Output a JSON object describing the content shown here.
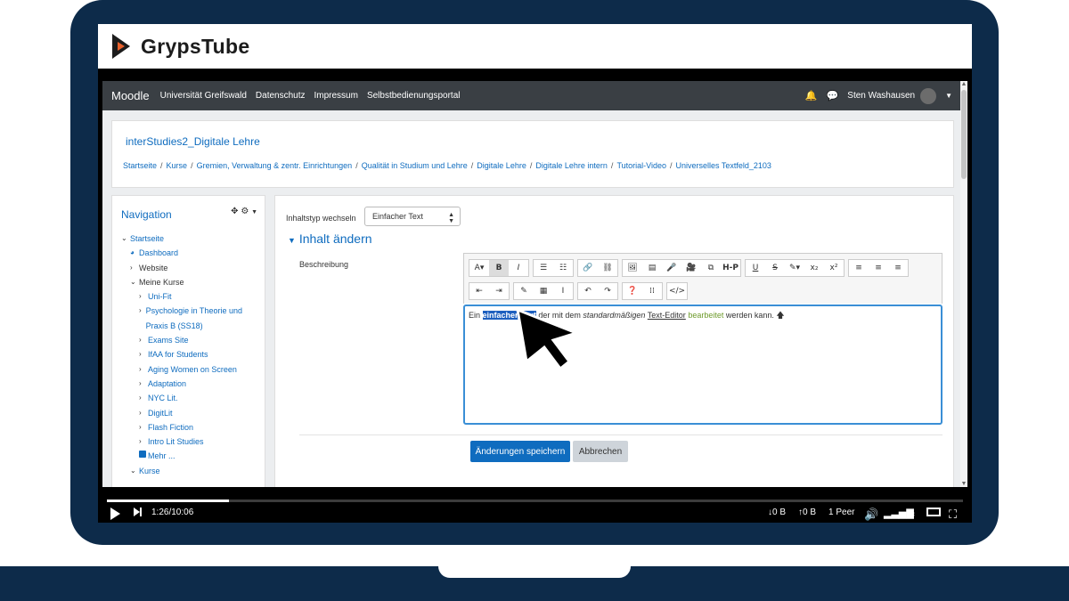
{
  "header": {
    "title": "GrypsTube",
    "logo_icon": "grypstube-logo-icon",
    "logo_colors": [
      "#1c1c1c",
      "#e8612c"
    ]
  },
  "navbar": {
    "brand": "Moodle",
    "links": [
      "Universität Greifswald",
      "Datenschutz",
      "Impressum",
      "Selbstbedienungsportal"
    ],
    "user_name": "Sten Washausen",
    "icons": [
      "bell-icon",
      "chat-icon",
      "avatar",
      "caret-down-icon"
    ]
  },
  "course": {
    "title": "interStudies2_Digitale Lehre",
    "breadcrumb": [
      "Startseite",
      "Kurse",
      "Gremien, Verwaltung & zentr. Einrichtungen",
      "Qualität in Studium und Lehre",
      "Digitale Lehre",
      "Digitale Lehre intern",
      "Tutorial-Video",
      "Universelles Textfeld_2103"
    ]
  },
  "navigation": {
    "heading": "Navigation",
    "items": [
      {
        "label": "Startseite",
        "chevron": "v",
        "indent": 0,
        "link": true
      },
      {
        "label": "Dashboard",
        "chevron": "",
        "indent": 1,
        "link": true,
        "icon": "dashboard-icon"
      },
      {
        "label": "Website",
        "chevron": ">",
        "indent": 1,
        "link": false
      },
      {
        "label": "Meine Kurse",
        "chevron": "v",
        "indent": 1,
        "link": false
      },
      {
        "label": "Uni-Fit",
        "chevron": ">",
        "indent": 2,
        "link": true
      },
      {
        "label": "Psychologie in Theorie und Praxis B (SS18)",
        "chevron": ">",
        "indent": 2,
        "link": true
      },
      {
        "label": "Exams Site",
        "chevron": ">",
        "indent": 2,
        "link": true
      },
      {
        "label": "IfAA for Students",
        "chevron": ">",
        "indent": 2,
        "link": true
      },
      {
        "label": "Aging Women on Screen",
        "chevron": ">",
        "indent": 2,
        "link": true
      },
      {
        "label": "Adaptation",
        "chevron": ">",
        "indent": 2,
        "link": true
      },
      {
        "label": "NYC Lit.",
        "chevron": ">",
        "indent": 2,
        "link": true
      },
      {
        "label": "DigitLit",
        "chevron": ">",
        "indent": 2,
        "link": true
      },
      {
        "label": "Flash Fiction",
        "chevron": ">",
        "indent": 2,
        "link": true
      },
      {
        "label": "Intro Lit Studies",
        "chevron": ">",
        "indent": 2,
        "link": true
      },
      {
        "label": "Mehr ...",
        "chevron": "",
        "indent": 2,
        "link": true,
        "icon": "folder-icon"
      },
      {
        "label": "Kurse",
        "chevron": "v",
        "indent": 1,
        "link": true
      }
    ]
  },
  "form": {
    "type_label": "Inhaltstyp wechseln",
    "type_value": "Einfacher Text",
    "section_title": "Inhalt ändern",
    "desc_label": "Beschreibung",
    "editor_text": {
      "t1": "Ein ",
      "t2": "einfacher Text",
      "t3": " der mit dem ",
      "t4": "standardmäßigen",
      "t5": " ",
      "t6": "Text-Editor",
      "t7": " ",
      "t8": "bearbeitet",
      "t9": " werden kann. ",
      "t10": "🡅"
    },
    "save_label": "Änderungen speichern",
    "cancel_label": "Abbrechen"
  },
  "toolbar": {
    "row1": [
      [
        "A▾",
        "B",
        "I"
      ],
      [
        "☰",
        "☷"
      ],
      [
        "🔗",
        "⛓"
      ],
      [
        "🖼",
        "▤",
        "🎤",
        "🎥",
        "⧉",
        "H-P"
      ],
      [
        "U",
        "S",
        "✎▾",
        "x₂",
        "x²"
      ],
      [
        "≡",
        "≡",
        "≡"
      ]
    ],
    "row2": [
      [
        "⇤",
        "⇥"
      ],
      [
        "✎",
        "▦",
        "I"
      ],
      [
        "↶",
        "↷"
      ],
      [
        "❓",
        "⁞⁞"
      ],
      [
        "</>"
      ]
    ]
  },
  "player": {
    "time": "1:26/10:06",
    "down": "↓0 B",
    "up": "↑0 B",
    "peers": "1 Peer",
    "progress": 0.143
  }
}
